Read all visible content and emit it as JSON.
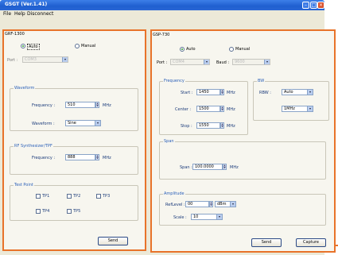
{
  "window": {
    "title": "GSGT (Ver.1.41)"
  },
  "menu": [
    "File",
    "Help",
    "Disconnect"
  ],
  "left": {
    "title": "GRF-1300",
    "mode": {
      "auto": "Auto",
      "manual": "Manual"
    },
    "port_label": "Port :",
    "port_value": "COM3",
    "waveform_group": "Waveform",
    "frequency_label": "Frequency :",
    "frequency_value": "510",
    "frequency_unit": "MHz",
    "waveform_label": "Waveform :",
    "waveform_value": "Sine",
    "rf_group": "RF Synthesizer/TPF",
    "rf_frequency_label": "Frequency :",
    "rf_frequency_value": "888",
    "rf_frequency_unit": "MHz",
    "testpoint_group": "Test Point",
    "testpoints": [
      "TP1",
      "TP2",
      "TP3",
      "TP4",
      "TP5"
    ],
    "send": "Send"
  },
  "right": {
    "title": "GSP-730",
    "mode": {
      "auto": "Auto",
      "manual": "Manual"
    },
    "port_label": "Port :",
    "port_value": "COM4",
    "baud_label": "Baud :",
    "baud_value": "9600",
    "frequency_group": "Frequency",
    "start_label": "Start :",
    "start_value": "1450",
    "center_label": "Center :",
    "center_value": "1500",
    "stop_label": "Stop :",
    "stop_value": "1550",
    "mhz": "MHz",
    "bw_group": "BW",
    "rbw_label": "RBW :",
    "rbw_value": "Auto",
    "rbw_value2": "1MHz",
    "span_group": "Span",
    "span_label": "Span :",
    "span_value": "100.0000",
    "span_unit": "MHz",
    "amplitude_group": "Amplitude",
    "reflevel_label": "RefLevel :",
    "reflevel_value": "00",
    "reflevel_unit": "dBm",
    "scale_label": "Scale :",
    "scale_value": "10",
    "send": "Send",
    "capture": "Capture"
  }
}
